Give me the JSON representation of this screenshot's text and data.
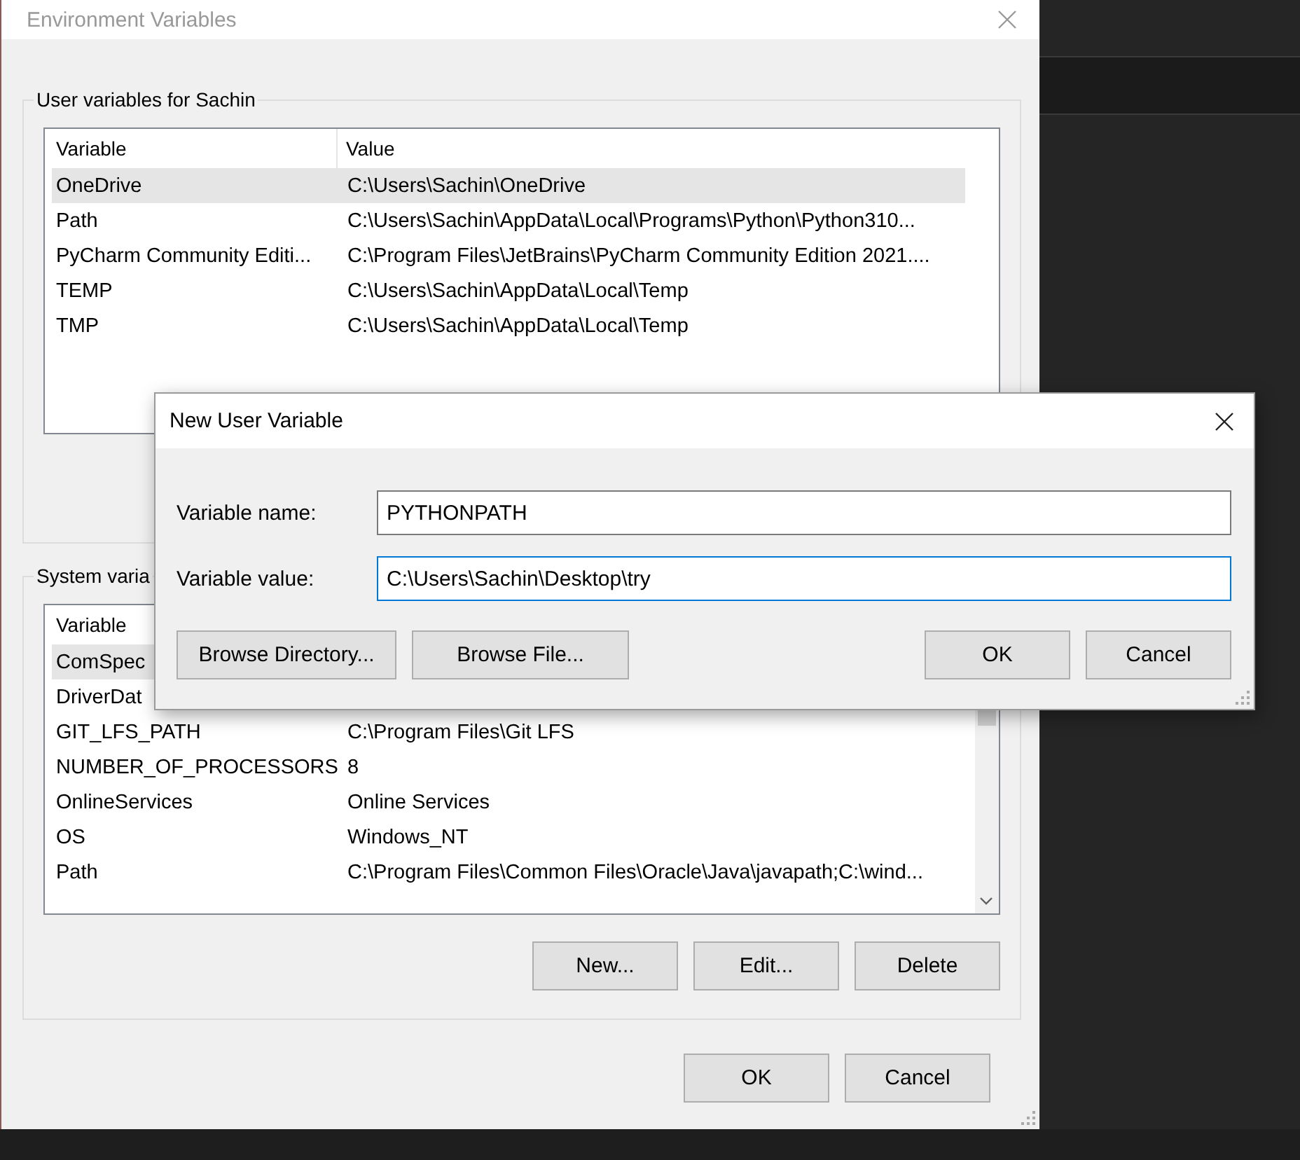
{
  "window": {
    "title": "Environment Variables"
  },
  "user_variables": {
    "title": "User variables for Sachin",
    "columns": [
      "Variable",
      "Value"
    ],
    "rows": [
      {
        "variable": "OneDrive",
        "value": "C:\\Users\\Sachin\\OneDrive",
        "selected": true
      },
      {
        "variable": "Path",
        "value": "C:\\Users\\Sachin\\AppData\\Local\\Programs\\Python\\Python310...",
        "selected": false
      },
      {
        "variable": "PyCharm Community Editi...",
        "value": "C:\\Program Files\\JetBrains\\PyCharm Community Edition 2021....",
        "selected": false
      },
      {
        "variable": "TEMP",
        "value": "C:\\Users\\Sachin\\AppData\\Local\\Temp",
        "selected": false
      },
      {
        "variable": "TMP",
        "value": "C:\\Users\\Sachin\\AppData\\Local\\Temp",
        "selected": false
      }
    ]
  },
  "system_variables": {
    "title": "System varia",
    "columns": [
      "Variable"
    ],
    "rows": [
      {
        "variable": "ComSpec",
        "selected": true
      },
      {
        "variable": "DriverDat",
        "selected": false
      },
      {
        "variable": "GIT_LFS_PATH",
        "value": "C:\\Program Files\\Git LFS",
        "selected": false
      },
      {
        "variable": "NUMBER_OF_PROCESSORS",
        "value": "8",
        "selected": false
      },
      {
        "variable": "OnlineServices",
        "value": "Online Services",
        "selected": false
      },
      {
        "variable": "OS",
        "value": "Windows_NT",
        "selected": false
      },
      {
        "variable": "Path",
        "value": "C:\\Program Files\\Common Files\\Oracle\\Java\\javapath;C:\\wind...",
        "selected": false
      }
    ],
    "buttons": [
      "New...",
      "Edit...",
      "Delete"
    ]
  },
  "buttons": [
    "OK",
    "Cancel"
  ],
  "dialog": {
    "title": "New User Variable",
    "fields": [
      {
        "label": "Variable name:",
        "value": "PYTHONPATH",
        "focused": false
      },
      {
        "label": "Variable value:",
        "value": "C:\\Users\\Sachin\\Desktop\\try",
        "focused": true
      }
    ],
    "browse_buttons": [
      "Browse Directory...",
      "Browse File..."
    ],
    "buttons": [
      "OK",
      "Cancel"
    ]
  }
}
